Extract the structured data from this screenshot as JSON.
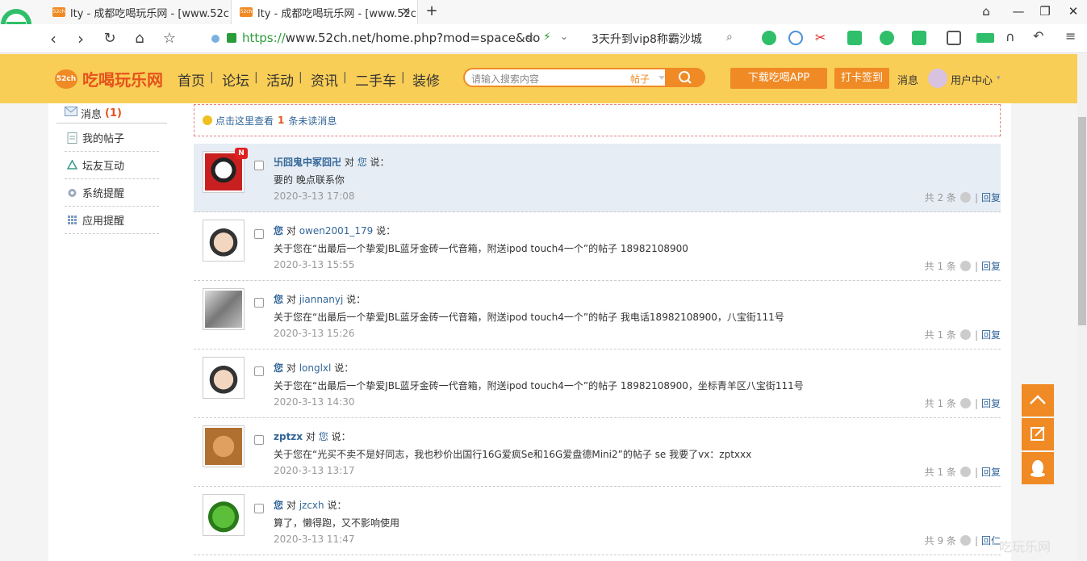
{
  "browser": {
    "tabs": [
      {
        "label": "lty - 成都吃喝玩乐网 - [www.52c",
        "favicon": "52ch"
      },
      {
        "label": "lty - 成都吃喝玩乐网 - [www.52c",
        "favicon": "52ch"
      }
    ],
    "new_tab_label": "+",
    "address": {
      "scheme": "https://",
      "rest": "www.52ch.net/home.php?mod=space&do"
    },
    "search_suggestion": "3天升到vip8称霸沙城"
  },
  "site": {
    "logo_badge": "52ch",
    "logo_text": "吃喝玩乐网",
    "nav": [
      "首页",
      "论坛",
      "活动",
      "资讯",
      "二手车",
      "装修"
    ],
    "nav_sep": "|",
    "search": {
      "placeholder": "请输入搜索内容",
      "category": "帖子"
    },
    "download_app": "下载吃喝APP",
    "checkin": "打卡签到",
    "messages": "消息",
    "user_center": "用户中心"
  },
  "sidebar": {
    "header": "消息",
    "header_count": "(1)",
    "items": [
      "我的帖子",
      "坛友互动",
      "系统提醒",
      "应用提醒"
    ]
  },
  "notice": {
    "prefix": "点击这里查看",
    "count": "1",
    "suffix": "条未读消息"
  },
  "messages": [
    {
      "from": "卐囧鬼中冢囧卍",
      "to_word": "对",
      "to": "您",
      "say": "说：",
      "body": "要的 晚点联系你",
      "time": "2020-3-13 17:08",
      "total": "共 2 条",
      "reply": "回复",
      "is_new": true,
      "new_badge": "N"
    },
    {
      "from": "您",
      "to_word": "对",
      "to": "owen2001_179",
      "say": "说：",
      "body": "关于您在“出最后一个挚爱JBL蓝牙金砖一代音箱，附送ipod touch4一个”的帖子 18982108900",
      "time": "2020-3-13 15:55",
      "total": "共 1 条",
      "reply": "回复"
    },
    {
      "from": "您",
      "to_word": "对",
      "to": "jiannanyj",
      "say": "说：",
      "body": "关于您在“出最后一个挚爱JBL蓝牙金砖一代音箱，附送ipod touch4一个”的帖子 我电话18982108900，八宝街111号",
      "time": "2020-3-13 15:26",
      "total": "共 1 条",
      "reply": "回复"
    },
    {
      "from": "您",
      "to_word": "对",
      "to": "longlxl",
      "say": "说：",
      "body": "关于您在“出最后一个挚爱JBL蓝牙金砖一代音箱，附送ipod touch4一个”的帖子 18982108900，坐标青羊区八宝街111号",
      "time": "2020-3-13 14:30",
      "total": "共 1 条",
      "reply": "回复"
    },
    {
      "from": "zptzx",
      "to_word": "对",
      "to": "您",
      "say": "说：",
      "body": "关于您在“光买不卖不是好同志，我也秒价出国行16G爱疯Se和16G爱盘德Mini2”的帖子 se 我要了vx：zptxxx",
      "time": "2020-3-13 13:17",
      "total": "共 1 条",
      "reply": "回复"
    },
    {
      "from": "您",
      "to_word": "对",
      "to": "jzcxh",
      "say": "说：",
      "body": "算了，懒得跑，又不影响使用",
      "time": "2020-3-13 11:47",
      "total": "共 9 条",
      "reply": "回仁"
    }
  ],
  "watermark": "吃玩乐网",
  "colors": {
    "accent": "#f08a24",
    "header_bg": "#f9ce56",
    "link": "#336699",
    "highlight_row": "#e6edf4"
  }
}
